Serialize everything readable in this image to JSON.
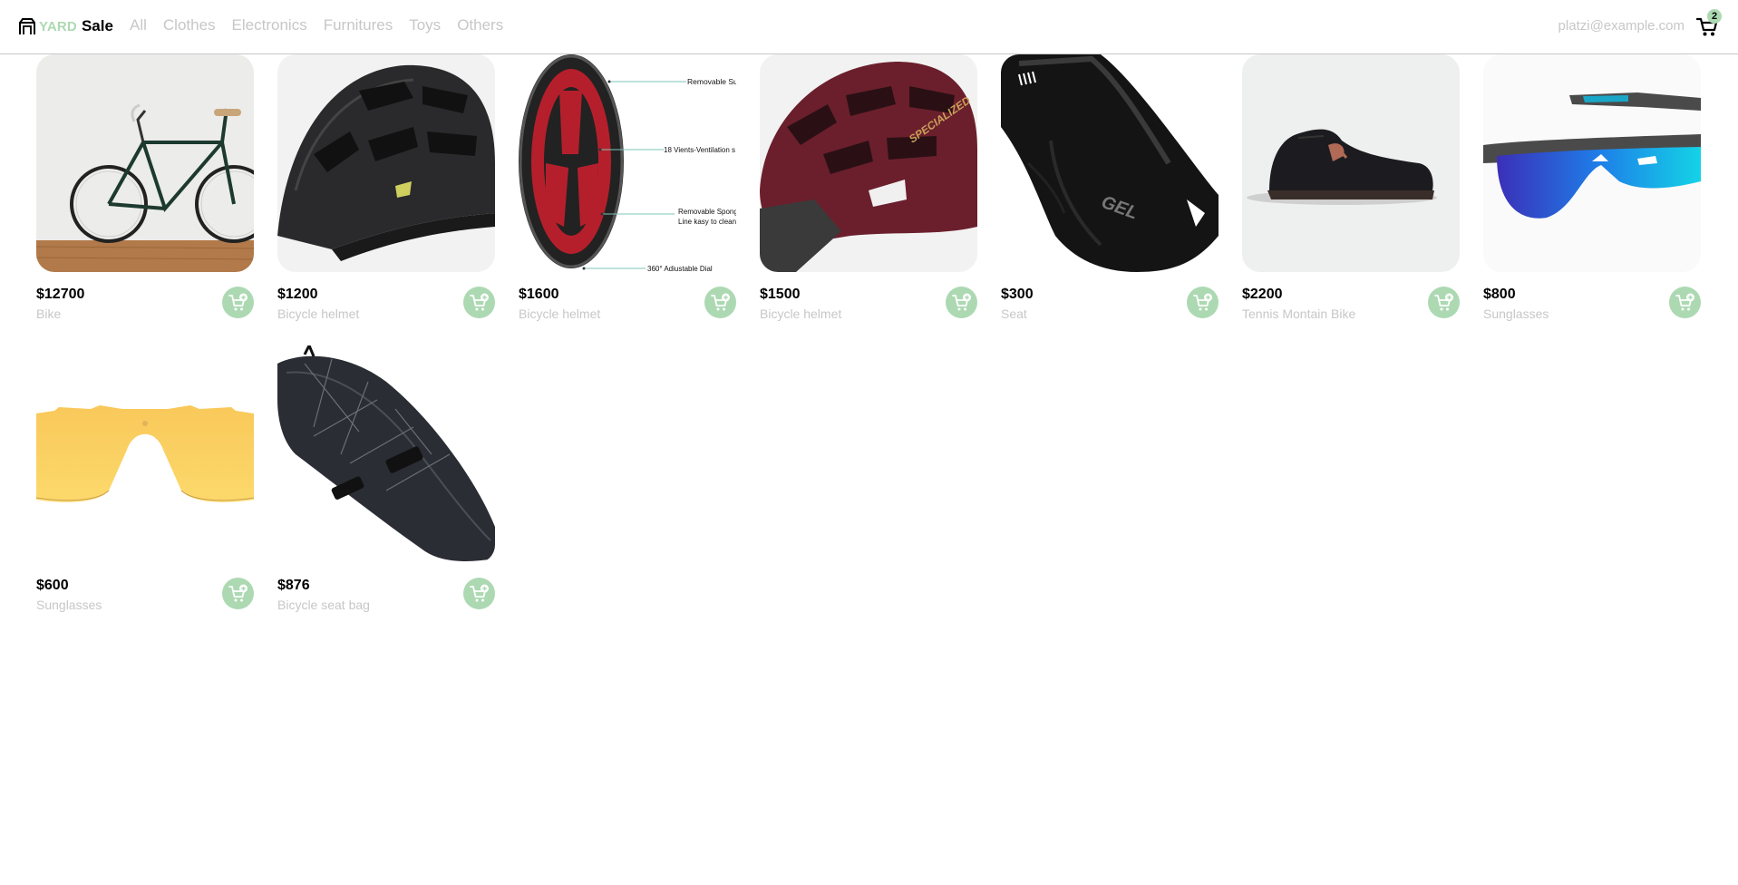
{
  "brand": {
    "yard": "YARD",
    "sale": "Sale"
  },
  "nav": {
    "items": [
      "All",
      "Clothes",
      "Electronics",
      "Furnitures",
      "Toys",
      "Others"
    ]
  },
  "user": {
    "email": "platzi@example.com",
    "cart_count": "2"
  },
  "colors": {
    "accent": "#acd9b2",
    "muted_text": "#c7c7c7",
    "border": "#c7c7c7"
  },
  "products": [
    {
      "price": "$12700",
      "name": "Bike",
      "image": "bike"
    },
    {
      "price": "$1200",
      "name": "Bicycle helmet",
      "image": "black-helmet"
    },
    {
      "price": "$1600",
      "name": "Bicycle helmet",
      "image": "helmet-interior-diagram",
      "image_annotations": [
        "Removable Sun",
        "18 Vients-Ventilation s",
        "Removable Spong",
        "Line kasy to clean",
        "360° Adiustable Dial"
      ]
    },
    {
      "price": "$1500",
      "name": "Bicycle helmet",
      "image": "maroon-helmet",
      "image_brand": "SPECIALIZED"
    },
    {
      "price": "$300",
      "name": "Seat",
      "image": "seat",
      "image_brand": "GEL"
    },
    {
      "price": "$2200",
      "name": "Tennis Montain Bike",
      "image": "shoe"
    },
    {
      "price": "$800",
      "name": "Sunglasses",
      "image": "blue-sunglasses"
    },
    {
      "price": "$600",
      "name": "Sunglasses",
      "image": "yellow-lens"
    },
    {
      "price": "$876",
      "name": "Bicycle seat bag",
      "image": "seat-bag"
    }
  ]
}
